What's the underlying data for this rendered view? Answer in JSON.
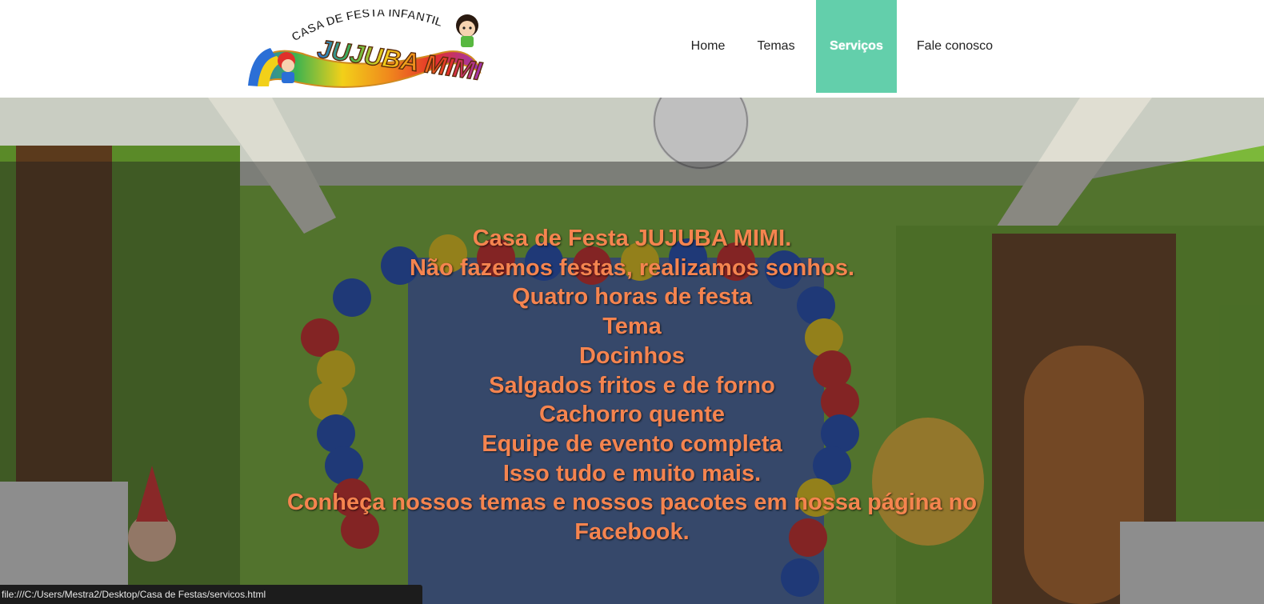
{
  "logo": {
    "arc_text": "CASA DE FESTA INFANTIL",
    "brand_text": "JUJUBA MIMI"
  },
  "nav": {
    "items": [
      {
        "label": "Home",
        "active": false
      },
      {
        "label": "Temas",
        "active": false
      },
      {
        "label": "Serviços",
        "active": true
      },
      {
        "label": "Fale conosco",
        "active": false
      }
    ],
    "active_color": "#63cfab"
  },
  "hero": {
    "lines": [
      "Casa de Festa JUJUBA MIMI.",
      "Não fazemos festas, realizamos sonhos.",
      "Quatro horas de festa",
      "Tema",
      "Docinhos",
      "Salgados fritos e de forno",
      "Cachorro quente",
      "Equipe de evento completa",
      "Isso tudo e muito mais.",
      "Conheça nossos temas e nossos pacotes em nossa página no Facebook."
    ],
    "text_color": "#f5844f"
  },
  "statusbar": {
    "url": "file:///C:/Users/Mestra2/Desktop/Casa de Festas/servicos.html"
  }
}
